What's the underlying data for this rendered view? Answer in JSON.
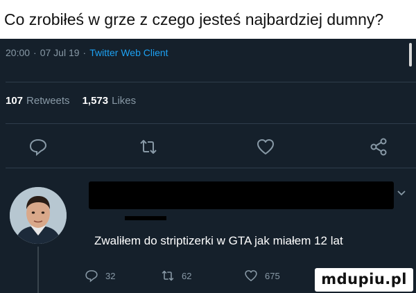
{
  "caption": {
    "text": "Co zrobiłeś w grze z czego jesteś najbardziej dumny?"
  },
  "tweet": {
    "time": "20:00",
    "date": "07 Jul 19",
    "client": "Twitter Web Client",
    "retweets_count": "107",
    "retweets_label": "Retweets",
    "likes_count": "1,573",
    "likes_label": "Likes",
    "actions": {
      "reply_icon": "comment-icon",
      "retweet_icon": "retweet-icon",
      "like_icon": "heart-icon",
      "share_icon": "share-icon"
    }
  },
  "reply": {
    "text": "Zwaliłem do striptizerki w GTA jak miałem 12 lat",
    "reply_count": "32",
    "retweet_count": "62",
    "like_count": "675"
  },
  "watermark": {
    "text": "mdupiu.pl"
  },
  "colors": {
    "background": "#15202b",
    "secondary_text": "#8899a6",
    "accent": "#1da1f2",
    "divider": "#2f3d4c"
  }
}
